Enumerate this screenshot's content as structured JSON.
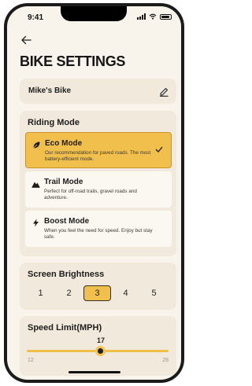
{
  "status_bar": {
    "time": "9:41"
  },
  "header": {
    "title": "BIKE SETTINGS"
  },
  "bike": {
    "name": "Mike's Bike"
  },
  "riding_mode": {
    "title": "Riding Mode",
    "selected": "Eco Mode",
    "options": [
      {
        "label": "Eco Mode",
        "icon": "leaf-icon",
        "description": "Our recommendation for paved roads. The most battery-efficient mode."
      },
      {
        "label": "Trail Mode",
        "icon": "mountain-icon",
        "description": "Perfect for off-road trails, gravel roads and adventure."
      },
      {
        "label": "Boost Mode",
        "icon": "lightning-icon",
        "description": "When you feel the need for speed. Enjoy but stay safe."
      }
    ]
  },
  "brightness": {
    "title": "Screen Brightness",
    "levels": [
      "1",
      "2",
      "3",
      "4",
      "5"
    ],
    "selected": "3"
  },
  "speed_limit": {
    "title": "Speed Limit(MPH)",
    "value": "17",
    "min": "12",
    "max": "28"
  },
  "colors": {
    "accent": "#f1bf4c",
    "background": "#f8f4ec",
    "card": "#f0e9dc"
  }
}
